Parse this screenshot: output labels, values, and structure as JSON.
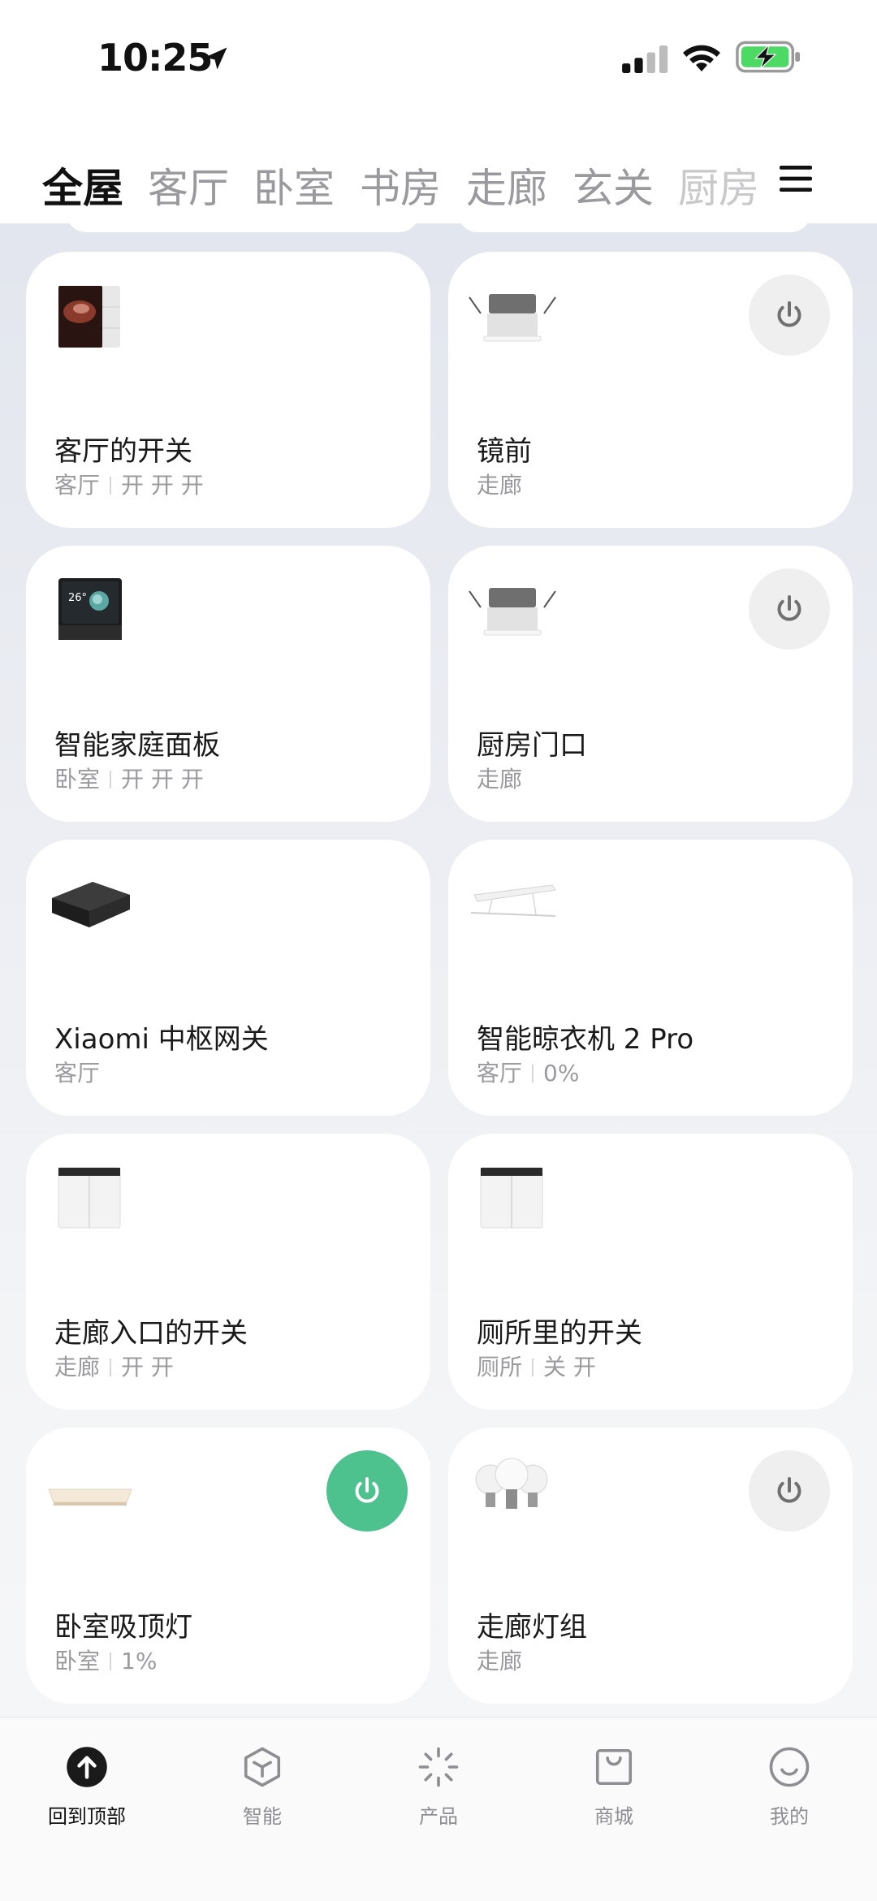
{
  "status_bar": {
    "time": "10:25",
    "icons": [
      "location-arrow-icon",
      "cellular-signal-icon",
      "wifi-icon",
      "battery-charging-icon"
    ],
    "battery_color": "#4cd964"
  },
  "tabs": [
    "全屋",
    "客厅",
    "卧室",
    "书房",
    "走廊",
    "玄关",
    "厨房"
  ],
  "active_tab": "全屋",
  "devices": [
    {
      "name": "客厅的开关",
      "room": "客厅",
      "status": "开 开 开",
      "icon": "smart-switch-image",
      "power_button": false
    },
    {
      "name": "镜前",
      "room": "走廊",
      "status": "",
      "icon": "downlight-image",
      "power_button": true,
      "power_on": false
    },
    {
      "name": "智能家庭面板",
      "room": "卧室",
      "status": "开 开 开",
      "icon": "home-panel-image",
      "power_button": false
    },
    {
      "name": "厨房门口",
      "room": "走廊",
      "status": "",
      "icon": "downlight-image",
      "power_button": true,
      "power_on": false
    },
    {
      "name": "Xiaomi 中枢网关",
      "room": "客厅",
      "status": "",
      "icon": "hub-gateway-image",
      "power_button": false
    },
    {
      "name": "智能晾衣机 2 Pro",
      "room": "客厅",
      "status": "0%",
      "icon": "clothes-dryer-image",
      "power_button": false
    },
    {
      "name": "走廊入口的开关",
      "room": "走廊",
      "status": "开 开",
      "icon": "double-switch-image",
      "power_button": false
    },
    {
      "name": "厕所里的开关",
      "room": "厕所",
      "status": "关 开",
      "icon": "double-switch-image",
      "power_button": false
    },
    {
      "name": "卧室吸顶灯",
      "room": "卧室",
      "status": "1%",
      "icon": "ceiling-light-image",
      "power_button": true,
      "power_on": true
    },
    {
      "name": "走廊灯组",
      "room": "走廊",
      "status": "",
      "icon": "bulb-group-image",
      "power_button": true,
      "power_on": false
    }
  ],
  "colors": {
    "power_on": "#4dc28f",
    "power_off_bg": "#efefef",
    "accent_text": "#111111"
  },
  "bottom_nav": [
    {
      "label": "回到顶部",
      "icon": "arrow-up-circle-icon"
    },
    {
      "label": "智能",
      "icon": "cube-icon"
    },
    {
      "label": "产品",
      "icon": "sparkle-icon"
    },
    {
      "label": "商城",
      "icon": "shopping-bag-icon"
    },
    {
      "label": "我的",
      "icon": "smiley-face-icon"
    }
  ]
}
